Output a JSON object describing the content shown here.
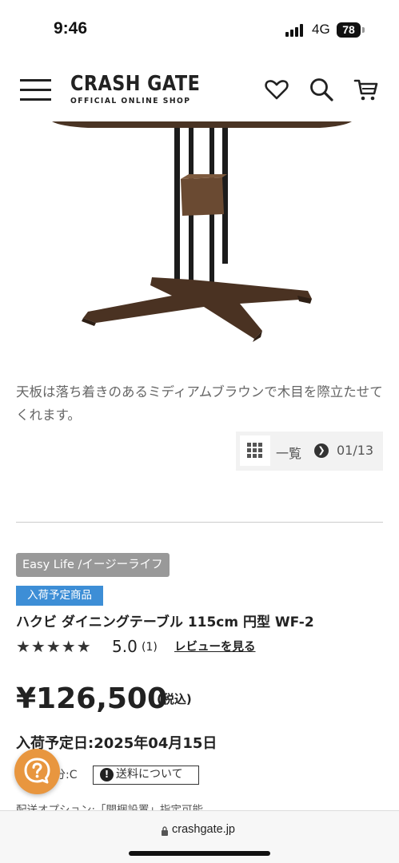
{
  "status_bar": {
    "time": "9:46",
    "network": "4G",
    "battery": "78"
  },
  "header": {
    "logo_main": "CRASH GATE",
    "logo_sub": "OFFICIAL ONLINE SHOP",
    "icons": [
      "menu-icon",
      "heart-icon",
      "search-icon",
      "cart-icon"
    ]
  },
  "gallery": {
    "caption": "天板は落ち着きのあるミディアムブラウンで木目を際立たせてくれます。",
    "list_label": "一覧",
    "page_count": "01/13"
  },
  "product": {
    "brand_tag": "Easy Life /イージーライフ",
    "stock_badge": "入荷予定商品",
    "title": "ハクビ ダイニングテーブル 115cm 円型 WF-2",
    "stars": "★★★★★",
    "rating": "5.0",
    "review_count": "(1)",
    "review_link": "レビューを見る",
    "price": "¥126,500",
    "tax_label": "(税込)",
    "arrival": "入荷予定日:2025年04月15日",
    "shipping_category": "分:C",
    "shipping_button": "送料について",
    "options_text": "配送オプション:「開梱設置」指定可能"
  },
  "browser": {
    "url": "crashgate.jp"
  },
  "colors": {
    "badge_blue": "#3d8ed6",
    "brand_tag_gray": "#999999",
    "help_fab_orange": "#e8963f"
  }
}
